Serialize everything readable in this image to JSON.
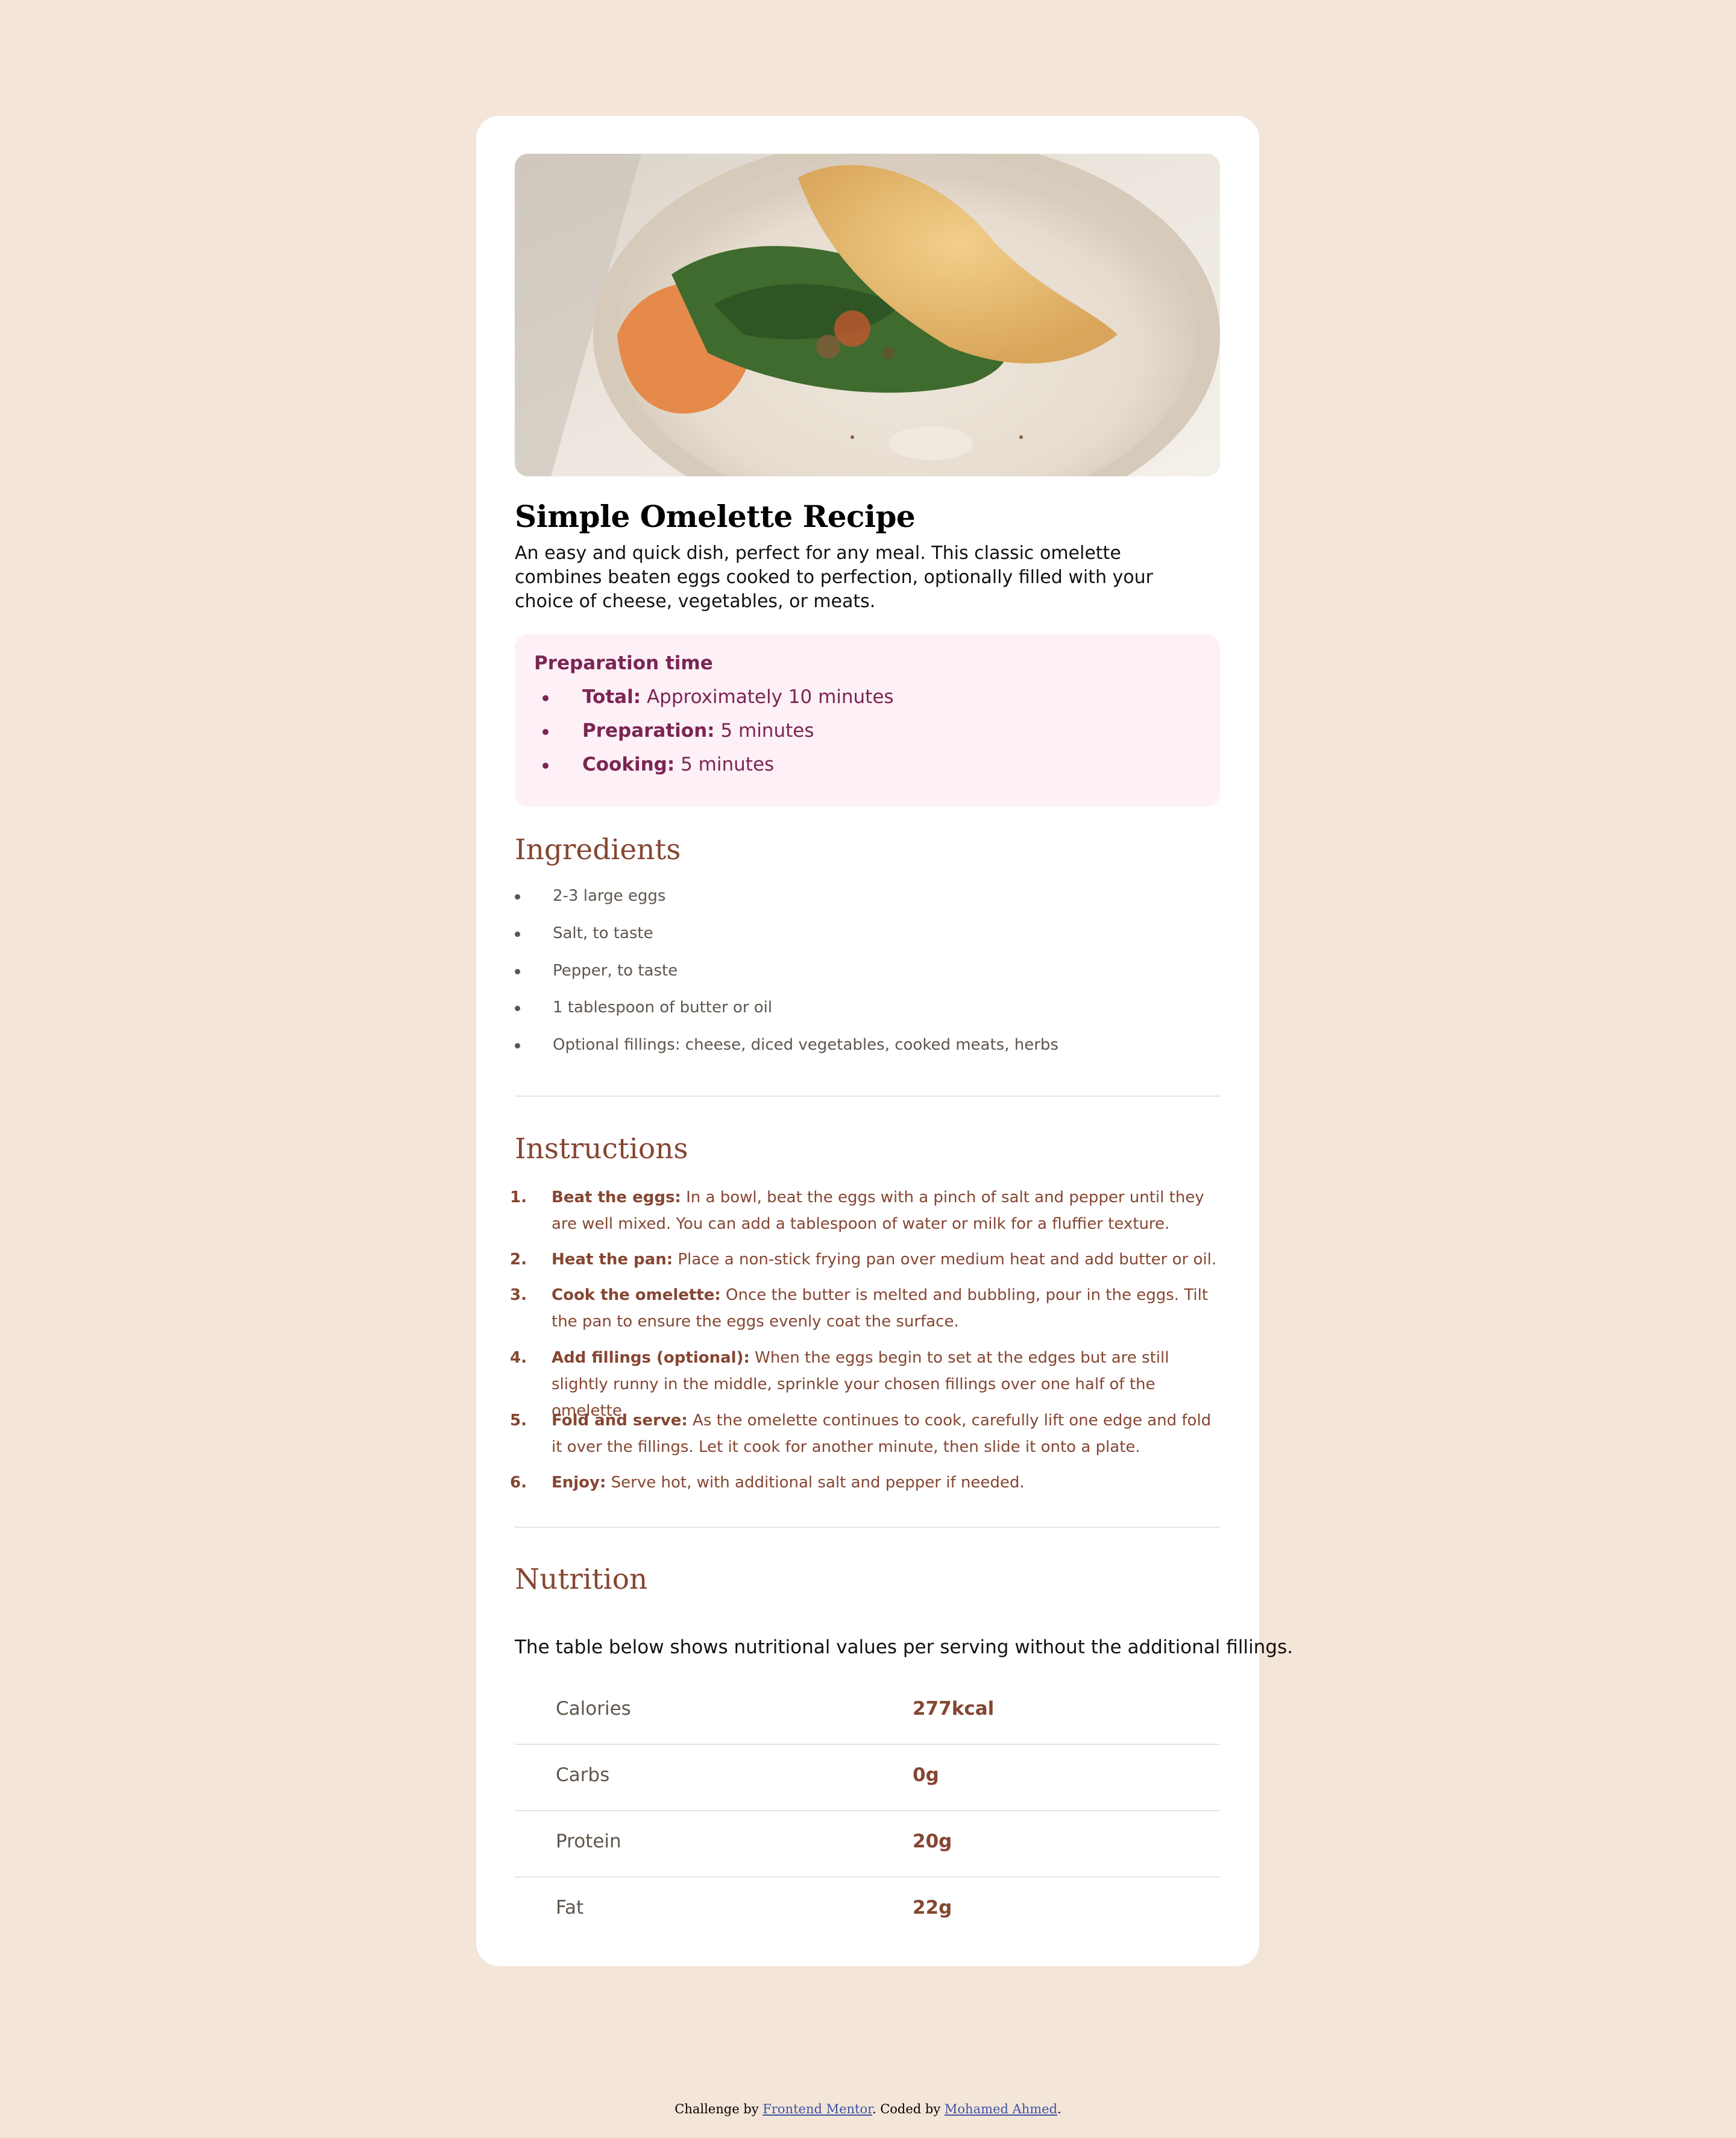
{
  "recipe": {
    "image_alt": "Omelette with spinach and herbs on a plate",
    "title": "Simple Omelette Recipe",
    "intro": "An easy and quick dish, perfect for any meal. This classic omelette combines beaten eggs cooked to perfection, optionally filled with your choice of cheese, vegetables, or meats."
  },
  "prep": {
    "title": "Preparation time",
    "items": [
      {
        "label": "Total:",
        "value": " Approximately 10 minutes"
      },
      {
        "label": "Preparation:",
        "value": " 5 minutes"
      },
      {
        "label": "Cooking:",
        "value": " 5 minutes"
      }
    ]
  },
  "ingredients": {
    "title": "Ingredients",
    "items": [
      "2-3 large eggs",
      "Salt, to taste",
      "Pepper, to taste",
      "1 tablespoon of butter or oil",
      "Optional fillings: cheese, diced vegetables, cooked meats, herbs"
    ]
  },
  "instructions": {
    "title": "Instructions",
    "steps": [
      {
        "num": "1.",
        "label": "Beat the eggs:",
        "text": " In a bowl, beat the eggs with a pinch of salt and pepper until they are well mixed. You can add a tablespoon of water or milk for a fluffier texture."
      },
      {
        "num": "2.",
        "label": "Heat the pan:",
        "text": " Place a non-stick frying pan over medium heat and add butter or oil."
      },
      {
        "num": "3.",
        "label": "Cook the omelette:",
        "text": " Once the butter is melted and bubbling, pour in the eggs. Tilt the pan to ensure the eggs evenly coat the surface."
      },
      {
        "num": "4.",
        "label": "Add fillings (optional):",
        "text": " When the eggs begin to set at the edges but are still slightly runny in the middle, sprinkle your chosen fillings over one half of the omelette."
      },
      {
        "num": "5.",
        "label": "Fold and serve:",
        "text": " As the omelette continues to cook, carefully lift one edge and fold it over the fillings. Let it cook for another minute, then slide it onto a plate."
      },
      {
        "num": "6.",
        "label": "Enjoy:",
        "text": " Serve hot, with additional salt and pepper if needed."
      }
    ]
  },
  "nutrition": {
    "title": "Nutrition",
    "description": "The table below shows nutritional values per serving without the additional fillings.",
    "rows": [
      {
        "label": "Calories",
        "value": "277kcal"
      },
      {
        "label": "Carbs",
        "value": "0g"
      },
      {
        "label": "Protein",
        "value": "20g"
      },
      {
        "label": "Fat",
        "value": "22g"
      }
    ]
  },
  "footer": {
    "prefix": "Challenge by ",
    "link1": "Frontend Mentor",
    "middle": ". Coded by ",
    "link2": "Mohamed Ahmed",
    "suffix": "."
  },
  "colors": {
    "background": "#f3e5d8",
    "card": "#ffffff",
    "accent_brown": "#854632",
    "accent_rose": "#7b2552",
    "prep_bg": "#fdf0f7",
    "muted_text": "#5f564d"
  }
}
